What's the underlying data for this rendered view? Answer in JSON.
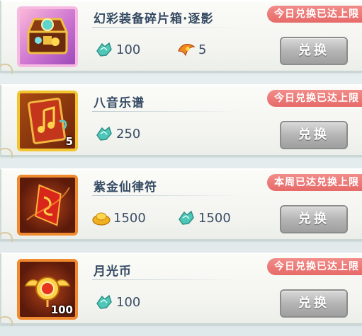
{
  "items": [
    {
      "name": "幻彩装备碎片箱·逐影",
      "badge": "今日兑换已达上限",
      "costs": [
        {
          "currency": "jade-currency-icon",
          "amount": "100"
        },
        {
          "currency": "phoenix-feather-currency-icon",
          "amount": "5"
        }
      ],
      "button": "兑换",
      "qty": ""
    },
    {
      "name": "八音乐谱",
      "badge": "今日兑换已达上限",
      "costs": [
        {
          "currency": "jade-currency-icon",
          "amount": "250"
        }
      ],
      "button": "兑换",
      "qty": "5"
    },
    {
      "name": "紫金仙律符",
      "badge": "本周已达兑换上限",
      "costs": [
        {
          "currency": "gold-ingot-currency-icon",
          "amount": "1500"
        },
        {
          "currency": "jade-currency-icon",
          "amount": "1500"
        }
      ],
      "button": "兑换",
      "qty": ""
    },
    {
      "name": "月光币",
      "badge": "今日兑换已达上限",
      "costs": [
        {
          "currency": "jade-currency-icon",
          "amount": "100"
        }
      ],
      "button": "兑换",
      "qty": "100"
    }
  ],
  "colors": {
    "badge": "#e66a68",
    "button_disabled": "#b5b5b5",
    "title": "#344a63"
  }
}
